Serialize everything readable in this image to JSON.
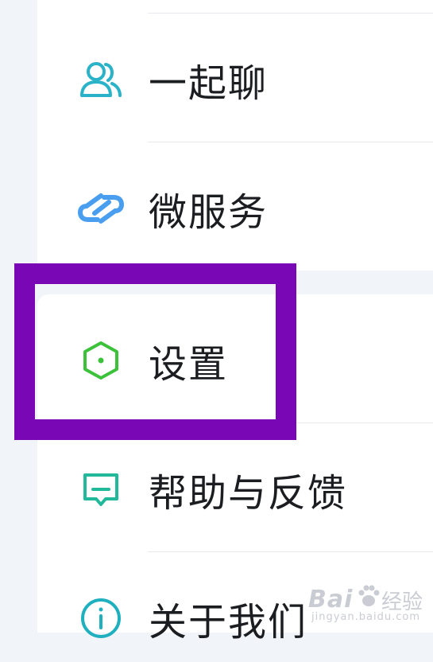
{
  "menu": {
    "items": [
      {
        "id": "yiqiliao",
        "label": "一起聊",
        "icon": "group-chat-icon",
        "color": "#2ab3c8"
      },
      {
        "id": "weifuwu",
        "label": "微服务",
        "icon": "link-icon",
        "color": "#4a9ef0"
      },
      {
        "id": "shezhi",
        "label": "设置",
        "icon": "hexagon-settings-icon",
        "color": "#3cc23a"
      },
      {
        "id": "bangzhu",
        "label": "帮助与反馈",
        "icon": "feedback-chat-icon",
        "color": "#22b89a"
      },
      {
        "id": "guanyu",
        "label": "关于我们",
        "icon": "info-icon",
        "color": "#1fb0c0"
      }
    ]
  },
  "highlight": {
    "target": "shezhi",
    "color": "#7a07b5"
  },
  "watermark": {
    "brand": "Bai",
    "brand_suffix": "经验",
    "url": "jingyan.baidu.com"
  }
}
